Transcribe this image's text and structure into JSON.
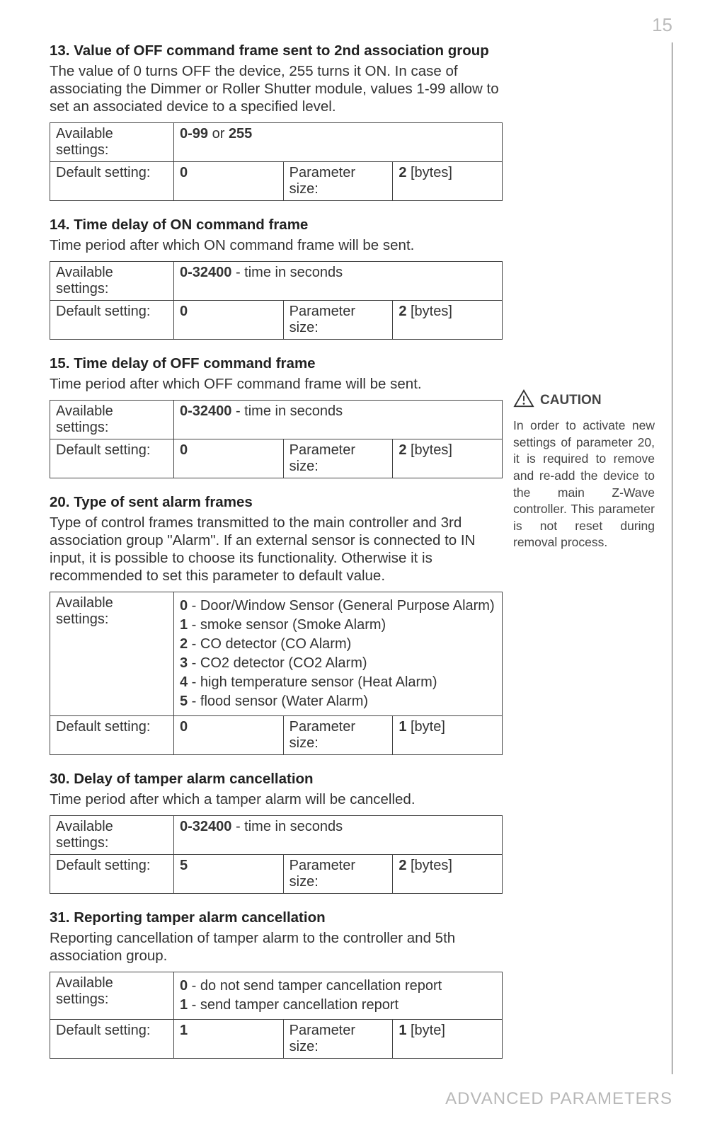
{
  "page_number": "15",
  "footer": "ADVANCED PARAMETERS",
  "labels": {
    "available": "Available settings:",
    "default": "Default setting:",
    "paramsize": "Parameter size:"
  },
  "caution": {
    "title": "CAUTION",
    "text": "In order to activate new settings of parameter 20, it is required to remove and re-add the device to the main Z-Wave controller. This parameter is not reset during removal process."
  },
  "params": {
    "p13": {
      "title": "13. Value of OFF command frame sent to 2nd association group",
      "desc": "The value of 0 turns OFF the device, 255 turns it ON. In case of associating the Dimmer or Roller Shutter module, values 1-99 allow to set an associated device to a specified level.",
      "avail_b1": "0-99",
      "avail_mid": " or ",
      "avail_b2": "255",
      "default": "0",
      "size_b": "2",
      "size_unit": " [bytes]"
    },
    "p14": {
      "title": "14. Time delay of ON command frame",
      "desc": "Time period after which ON command frame will be sent.",
      "avail_b": "0-32400",
      "avail_rest": " - time in seconds",
      "default": "0",
      "size_b": "2",
      "size_unit": " [bytes]"
    },
    "p15": {
      "title": "15. Time delay of OFF command frame",
      "desc": "Time period after which OFF command frame will be sent.",
      "avail_b": "0-32400",
      "avail_rest": " - time in seconds",
      "default": "0",
      "size_b": "2",
      "size_unit": " [bytes]"
    },
    "p20": {
      "title": "20. Type of sent alarm frames",
      "desc": "Type of control frames transmitted to the main controller and 3rd association group \"Alarm\". If an external sensor is connected to IN input, it is possible to choose its functionality. Otherwise it is recommended to set this parameter to default value.",
      "opts": [
        {
          "n": "0",
          "t": " - Door/Window Sensor (General Purpose Alarm)"
        },
        {
          "n": "1",
          "t": " - smoke sensor (Smoke Alarm)"
        },
        {
          "n": "2",
          "t": " - CO detector (CO Alarm)"
        },
        {
          "n": "3",
          "t": " - CO2 detector (CO2 Alarm)"
        },
        {
          "n": "4",
          "t": " - high temperature sensor (Heat Alarm)"
        },
        {
          "n": "5",
          "t": " - flood sensor (Water Alarm)"
        }
      ],
      "default": "0",
      "size_b": "1",
      "size_unit": " [byte]"
    },
    "p30": {
      "title": "30. Delay of tamper alarm cancellation",
      "desc": "Time period after which a tamper alarm will be cancelled.",
      "avail_b": "0-32400",
      "avail_rest": " - time in seconds",
      "default": "5",
      "size_b": "2",
      "size_unit": " [bytes]"
    },
    "p31": {
      "title": "31. Reporting tamper alarm cancellation",
      "desc": "Reporting cancellation of tamper alarm to the controller and 5th association group.",
      "opts": [
        {
          "n": "0",
          "t": " - do not send tamper cancellation report"
        },
        {
          "n": "1",
          "t": " - send tamper cancellation report"
        }
      ],
      "default": "1",
      "size_b": "1",
      "size_unit": " [byte]"
    }
  }
}
